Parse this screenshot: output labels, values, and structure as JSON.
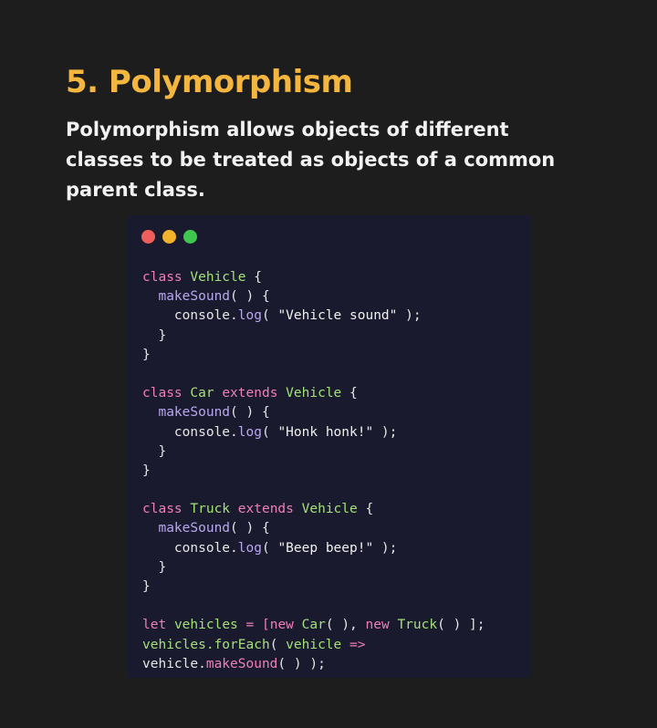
{
  "heading": "5. Polymorphism",
  "description_lines": [
    "Polymorphism allows objects of different",
    "classes to be treated as objects of a common",
    "parent class."
  ],
  "window_dots": [
    {
      "name": "close-dot",
      "color": "#ee5f5b"
    },
    {
      "name": "minimize-dot",
      "color": "#f2b12a"
    },
    {
      "name": "maximize-dot",
      "color": "#3fc64f"
    }
  ],
  "colors": {
    "title": "#f4b63e",
    "keyword": "#ef7fb8",
    "class_name": "#a3e07a",
    "method": "#b9a7f0",
    "code_background": "#1a1a2e",
    "page_background": "#1d1d1d"
  },
  "code": {
    "l1_kw": "class",
    "l1_cls": "Vehicle",
    "l1_pun": " {",
    "l2_fn": "makeSound",
    "l2_pun": "( ) {",
    "l3_a": "console.",
    "l3_fn": "log",
    "l3_b": "( ",
    "l3_str": "\"Vehicle sound\"",
    "l3_c": " );",
    "l4": "}",
    "l5": "}",
    "l7_kw": "class",
    "l7_cls": "Car",
    "l7_kw2": "extends",
    "l7_cls2": "Vehicle",
    "l7_pun": " {",
    "l8_fn": "makeSound",
    "l8_pun": "( ) {",
    "l9_a": "console.",
    "l9_fn": "log",
    "l9_b": "( ",
    "l9_str": "\"Honk honk!\"",
    "l9_c": " );",
    "l10": "}",
    "l11": "}",
    "l13_kw": "class",
    "l13_cls": "Truck",
    "l13_kw2": "extends",
    "l13_cls2": "Vehicle",
    "l13_pun": " {",
    "l14_fn": "makeSound",
    "l14_pun": "( ) {",
    "l15_a": "console.",
    "l15_fn": "log",
    "l15_b": "( ",
    "l15_str": "\"Beep beep!\"",
    "l15_c": " );",
    "l16": "}",
    "l17": "}",
    "l19_kw": "let",
    "l19_var": "vehicles",
    "l19_op": "=",
    "l19_br": "[",
    "l19_kw2": "new",
    "l19_cls": "Car",
    "l19_p1": "( ),",
    "l19_kw3": "new",
    "l19_cls2": "Truck",
    "l19_p2": "( ) ];",
    "l20_var": "vehicles.",
    "l20_fn": "forEach",
    "l20_p1": "( ",
    "l20_arg": "vehicle",
    "l20_arrow": "=>",
    "l21_var": "vehicle.",
    "l21_fn": "makeSound",
    "l21_p": "( ) );"
  }
}
